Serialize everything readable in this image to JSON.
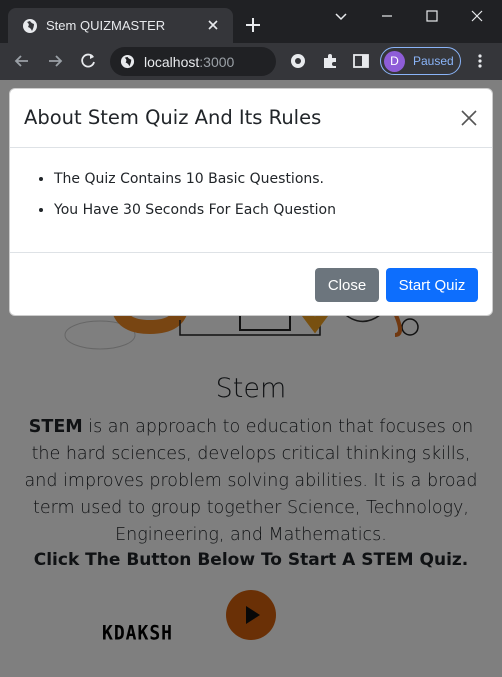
{
  "browser": {
    "tab_title": "Stem QUIZMASTER",
    "url_host": "localhost",
    "url_port": ":3000",
    "profile_initial": "D",
    "profile_status": "Paused"
  },
  "page": {
    "title": "Stem",
    "description_lead": "STEM",
    "description_rest": " is an approach to education that focuses on the hard sciences, develops critical thinking skills, and improves problem solving abilities. It is a broad term used to group together Science, Technology, Engineering, and Mathematics.",
    "cta_text": "Click The Button Below To Start A STEM Quiz.",
    "author_logo": "KDAKSH"
  },
  "modal": {
    "title": "About Stem Quiz And Its Rules",
    "rules": [
      "The Quiz Contains 10 Basic Questions.",
      "You Have 30 Seconds For Each Question"
    ],
    "close_label": "Close",
    "start_label": "Start Quiz"
  },
  "colors": {
    "accent": "#0d6efd",
    "secondary": "#6c757d",
    "play": "#d4600c"
  }
}
